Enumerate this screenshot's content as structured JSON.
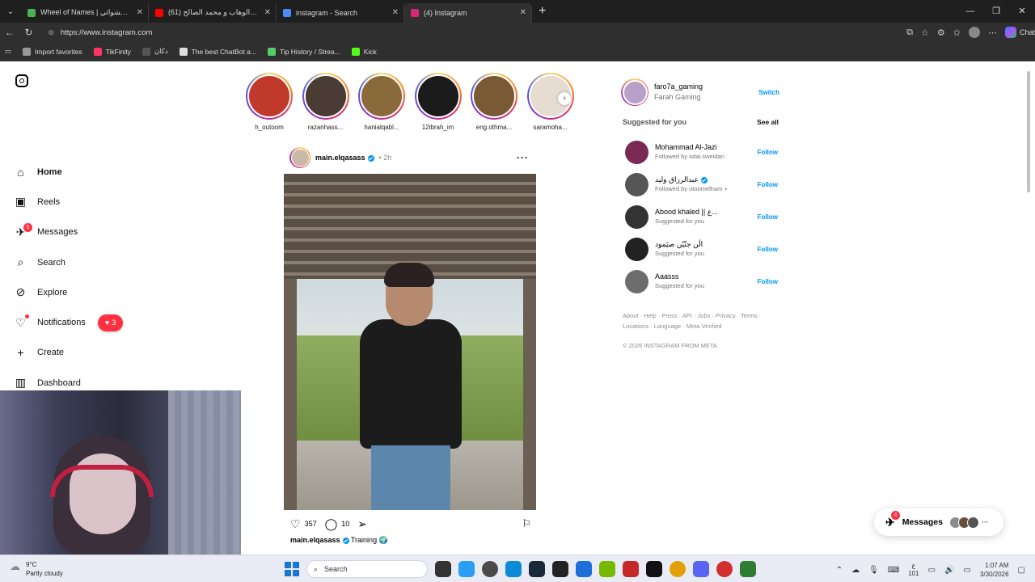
{
  "browser": {
    "tabs": [
      {
        "title": "Wheel of Names | الاسم العشوائي",
        "favicon_color": "#4caf50",
        "active": false
      },
      {
        "title": "(61) ياسر عبد الوهاب و محمد الصالح",
        "favicon_color": "#ff0000",
        "active": false
      },
      {
        "title": "instagram - Search",
        "favicon_color": "#4c8bf5",
        "active": false
      },
      {
        "title": "(4) Instagram",
        "favicon_color": "#d62976",
        "active": true
      }
    ],
    "url": "https://www.instagram.com",
    "bookmarks": [
      {
        "label": "Import favorites",
        "color": "#999999"
      },
      {
        "label": "TikFinity",
        "color": "#ff3366"
      },
      {
        "label": "دكان",
        "color": "#555555"
      },
      {
        "label": "The best ChatBot a...",
        "color": "#dddddd"
      },
      {
        "label": "Tip History / Strea...",
        "color": "#55cc66"
      },
      {
        "label": "Kick",
        "color": "#53fc18"
      }
    ],
    "chat_label": "Chat"
  },
  "sidebar": {
    "items": [
      {
        "label": "Home",
        "icon": "home-icon",
        "glyph": "⌂"
      },
      {
        "label": "Reels",
        "icon": "reels-icon",
        "glyph": "▣"
      },
      {
        "label": "Messages",
        "icon": "messages-icon",
        "glyph": "✈",
        "badge": "5"
      },
      {
        "label": "Search",
        "icon": "search-icon",
        "glyph": "⌕"
      },
      {
        "label": "Explore",
        "icon": "explore-icon",
        "glyph": "⊘"
      },
      {
        "label": "Notifications",
        "icon": "heart-icon",
        "glyph": "♡",
        "pill": "3"
      },
      {
        "label": "Create",
        "icon": "plus-icon",
        "glyph": "+"
      },
      {
        "label": "Dashboard",
        "icon": "dashboard-icon",
        "glyph": "▥"
      }
    ]
  },
  "stories": [
    {
      "name": "h_outoom",
      "color": "#c0392b"
    },
    {
      "name": "razanhass...",
      "color": "#4a3b35"
    },
    {
      "name": "hanialqabl...",
      "color": "#8a6a3a"
    },
    {
      "name": "12ibrah_im",
      "color": "#1b1b1b"
    },
    {
      "name": "eng.othma...",
      "color": "#7a5a35"
    },
    {
      "name": "saramoha...",
      "color": "#e6dcd2"
    }
  ],
  "post": {
    "username": "main.elqasass",
    "time": "2h",
    "likes": "357",
    "comments": "10",
    "caption_user": "main.elqasass",
    "caption_text": "Training 🌍"
  },
  "account": {
    "username": "faro7a_gaming",
    "display_name": "Farah Gaming",
    "switch_label": "Switch"
  },
  "suggestions": {
    "heading": "Suggested for you",
    "see_all": "See all",
    "follow_label": "Follow",
    "items": [
      {
        "name": "Mohammad Al-Jazi",
        "sub": "Followed by odai.sweidan",
        "color": "#7b2a55",
        "verified": false
      },
      {
        "name": "عبدالرزاق وليد",
        "sub": "Followed by utoomelham +",
        "color": "#555555",
        "verified": true
      },
      {
        "name": "Abood khaled || ع...",
        "sub": "Suggested for you",
        "color": "#333333",
        "verified": false
      },
      {
        "name": "اڷن جنّيّن صيٓمود",
        "sub": "Suggested for you",
        "color": "#222222",
        "verified": false
      },
      {
        "name": "Aaasss",
        "sub": "Suggested for you",
        "color": "#6d6d6d",
        "verified": false
      }
    ]
  },
  "footer": {
    "links": "About · Help · Press · API · Jobs · Privacy · Terms · Locations · Language · Meta Verified",
    "copyright": "© 2026 INSTAGRAM FROM META"
  },
  "messages_fab": {
    "label": "Messages",
    "badge": "4"
  },
  "taskbar": {
    "weather_temp": "9°C",
    "weather_desc": "Partly cloudy",
    "search_label": "Search",
    "time": "1:07 AM",
    "date": "3/30/2026",
    "lang": "ع",
    "lang_sub": "101"
  }
}
